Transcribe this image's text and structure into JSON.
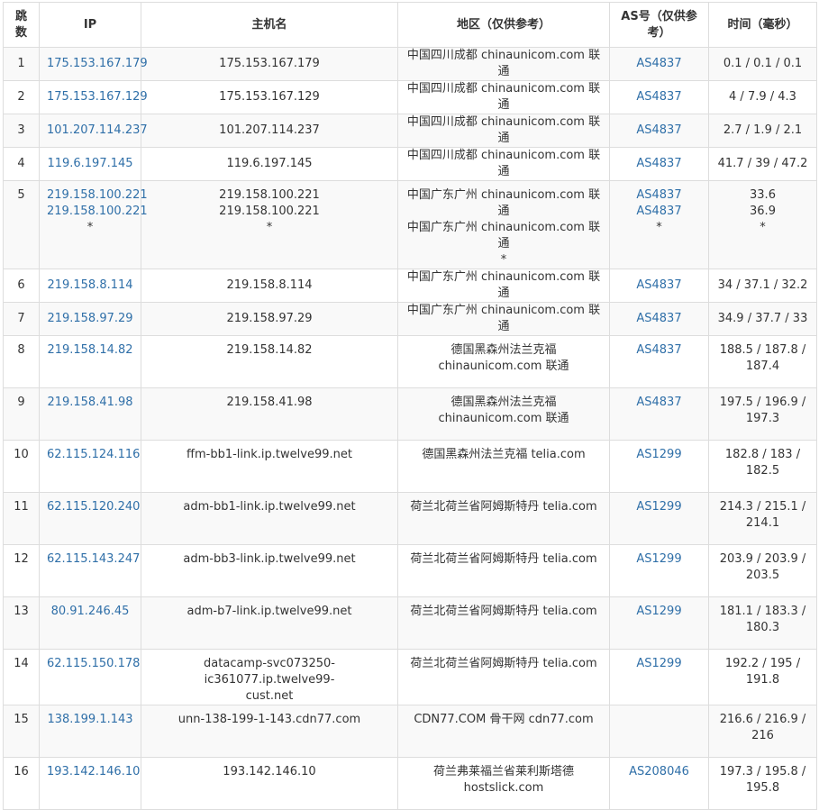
{
  "headers": {
    "hop": "跳数",
    "ip": "IP",
    "host": "主机名",
    "region": "地区（仅供参考）",
    "asn": "AS号（仅供参考）",
    "time": "时间（毫秒）"
  },
  "rows": [
    {
      "hop": "1",
      "ips": [
        "175.153.167.179"
      ],
      "hosts": [
        "175.153.167.179"
      ],
      "regions": [
        "中国四川成都 chinaunicom.com 联通"
      ],
      "asns": [
        "AS4837"
      ],
      "times": [
        "0.1 / 0.1 / 0.1"
      ]
    },
    {
      "hop": "2",
      "ips": [
        "175.153.167.129"
      ],
      "hosts": [
        "175.153.167.129"
      ],
      "regions": [
        "中国四川成都 chinaunicom.com 联通"
      ],
      "asns": [
        "AS4837"
      ],
      "times": [
        "4 / 7.9 / 4.3"
      ]
    },
    {
      "hop": "3",
      "ips": [
        "101.207.114.237"
      ],
      "hosts": [
        "101.207.114.237"
      ],
      "regions": [
        "中国四川成都 chinaunicom.com 联通"
      ],
      "asns": [
        "AS4837"
      ],
      "times": [
        "2.7 / 1.9 / 2.1"
      ]
    },
    {
      "hop": "4",
      "ips": [
        "119.6.197.145"
      ],
      "hosts": [
        "119.6.197.145"
      ],
      "regions": [
        "中国四川成都 chinaunicom.com 联通"
      ],
      "asns": [
        "AS4837"
      ],
      "times": [
        "41.7 / 39 / 47.2"
      ]
    },
    {
      "hop": "5",
      "ips": [
        "219.158.100.221",
        "219.158.100.221",
        "*"
      ],
      "hosts": [
        "219.158.100.221",
        "219.158.100.221",
        "*"
      ],
      "regions": [
        "中国广东广州 chinaunicom.com 联通",
        "中国广东广州 chinaunicom.com 联通",
        "*"
      ],
      "asns": [
        "AS4837",
        "AS4837",
        "*"
      ],
      "times": [
        "33.6",
        "36.9",
        "*"
      ]
    },
    {
      "hop": "6",
      "ips": [
        "219.158.8.114"
      ],
      "hosts": [
        "219.158.8.114"
      ],
      "regions": [
        "中国广东广州 chinaunicom.com 联通"
      ],
      "asns": [
        "AS4837"
      ],
      "times": [
        "34 / 37.1 / 32.2"
      ]
    },
    {
      "hop": "7",
      "ips": [
        "219.158.97.29"
      ],
      "hosts": [
        "219.158.97.29"
      ],
      "regions": [
        "中国广东广州 chinaunicom.com 联通"
      ],
      "asns": [
        "AS4837"
      ],
      "times": [
        "34.9 / 37.7 / 33"
      ]
    },
    {
      "hop": "8",
      "ips": [
        "219.158.14.82"
      ],
      "hosts": [
        "219.158.14.82"
      ],
      "regions": [
        "德国黑森州法兰克福",
        "chinaunicom.com 联通"
      ],
      "asns": [
        "AS4837"
      ],
      "times": [
        "188.5 / 187.8 /",
        "187.4"
      ]
    },
    {
      "hop": "9",
      "ips": [
        "219.158.41.98"
      ],
      "hosts": [
        "219.158.41.98"
      ],
      "regions": [
        "德国黑森州法兰克福",
        "chinaunicom.com 联通"
      ],
      "asns": [
        "AS4837"
      ],
      "times": [
        "197.5 / 196.9 /",
        "197.3"
      ]
    },
    {
      "hop": "10",
      "ips": [
        "62.115.124.116"
      ],
      "hosts": [
        "ffm-bb1-link.ip.twelve99.net"
      ],
      "regions": [
        "德国黑森州法兰克福 telia.com"
      ],
      "asns": [
        "AS1299"
      ],
      "times": [
        "182.8 / 183 /",
        "182.5"
      ]
    },
    {
      "hop": "11",
      "ips": [
        "62.115.120.240"
      ],
      "hosts": [
        "adm-bb1-link.ip.twelve99.net"
      ],
      "regions": [
        "荷兰北荷兰省阿姆斯特丹 telia.com"
      ],
      "asns": [
        "AS1299"
      ],
      "times": [
        "214.3 / 215.1 /",
        "214.1"
      ]
    },
    {
      "hop": "12",
      "ips": [
        "62.115.143.247"
      ],
      "hosts": [
        "adm-bb3-link.ip.twelve99.net"
      ],
      "regions": [
        "荷兰北荷兰省阿姆斯特丹 telia.com"
      ],
      "asns": [
        "AS1299"
      ],
      "times": [
        "203.9 / 203.9 /",
        "203.5"
      ]
    },
    {
      "hop": "13",
      "ips": [
        "80.91.246.45"
      ],
      "hosts": [
        "adm-b7-link.ip.twelve99.net"
      ],
      "regions": [
        "荷兰北荷兰省阿姆斯特丹 telia.com"
      ],
      "asns": [
        "AS1299"
      ],
      "times": [
        "181.1 / 183.3 /",
        "180.3"
      ]
    },
    {
      "hop": "14",
      "ips": [
        "62.115.150.178"
      ],
      "hosts": [
        "datacamp-svc073250-ic361077.ip.twelve99-",
        "cust.net"
      ],
      "regions": [
        "荷兰北荷兰省阿姆斯特丹 telia.com"
      ],
      "asns": [
        "AS1299"
      ],
      "times": [
        "192.2 / 195 /",
        "191.8"
      ]
    },
    {
      "hop": "15",
      "ips": [
        "138.199.1.143"
      ],
      "hosts": [
        "unn-138-199-1-143.cdn77.com"
      ],
      "regions": [
        "CDN77.COM 骨干网 cdn77.com"
      ],
      "asns": [],
      "times": [
        "216.6 / 216.9 /",
        "216"
      ]
    },
    {
      "hop": "16",
      "ips": [
        "193.142.146.10"
      ],
      "hosts": [
        "193.142.146.10"
      ],
      "regions": [
        "荷兰弗莱福兰省莱利斯塔德",
        "hostslick.com"
      ],
      "asns": [
        "AS208046"
      ],
      "times": [
        "197.3 / 195.8 /",
        "195.8"
      ]
    }
  ]
}
